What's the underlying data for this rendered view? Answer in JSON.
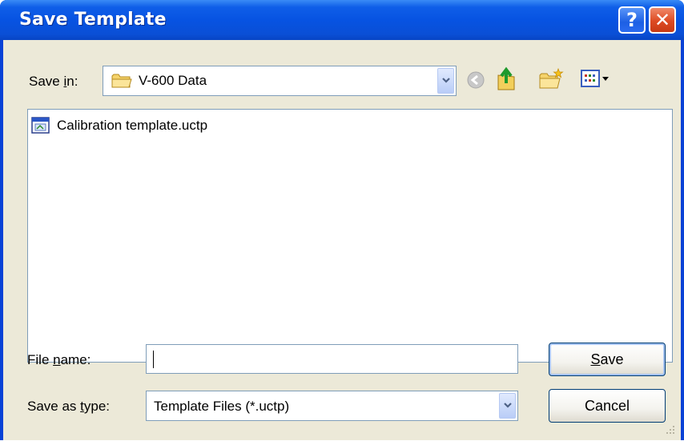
{
  "window": {
    "title": "Save Template",
    "help_glyph": "?",
    "close_glyph": "✕"
  },
  "savein": {
    "label": "Save in:",
    "mnemonic": "i",
    "folder": "V-600 Data",
    "folder_icon": "folder-icon"
  },
  "toolbar": {
    "icons": [
      "back-icon",
      "up-folder-icon",
      "new-folder-icon",
      "view-menu-icon"
    ]
  },
  "files": [
    {
      "name": "Calibration template.uctp",
      "icon": "template-file-icon"
    }
  ],
  "filename": {
    "label": "File name:",
    "mnemonic": "n",
    "value": ""
  },
  "filetype": {
    "label": "Save as type:",
    "mnemonic": "t",
    "value": "Template Files (*.uctp)"
  },
  "buttons": {
    "save": "Save",
    "save_mnemonic": "S",
    "cancel": "Cancel"
  },
  "colors": {
    "titlebar": "#0753e2",
    "dialog_bg": "#ece9d8",
    "close_button": "#dd4a22"
  }
}
